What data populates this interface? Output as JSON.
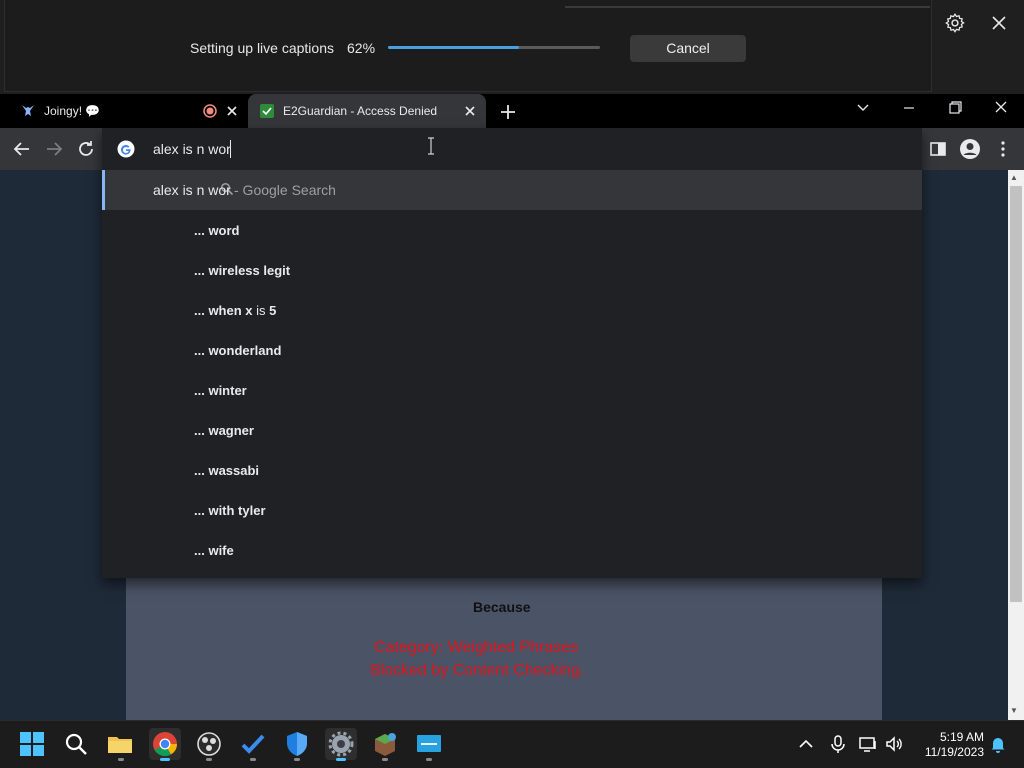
{
  "captions": {
    "status": "Setting up live captions",
    "progress_label": "62%",
    "progress_fraction": 0.62,
    "cancel_label": "Cancel"
  },
  "tabs": [
    {
      "title": "Joingy! 💬"
    },
    {
      "title": "E2Guardian - Access Denied"
    }
  ],
  "omnibox": {
    "query": "alex is n wor",
    "top_suggestion": {
      "query": "alex is n wor",
      "source": " - Google Search"
    },
    "suggestions": [
      {
        "prefix": "... wo",
        "mid": "",
        "rest": "rd"
      },
      {
        "prefix": "... w",
        "mid": "",
        "rest": "ireless legit"
      },
      {
        "prefix": "... when x",
        "mid": " is ",
        "rest": "5"
      },
      {
        "prefix": "... wo",
        "mid": "",
        "rest": "nderland"
      },
      {
        "prefix": "... w",
        "mid": "",
        "rest": "inter"
      },
      {
        "prefix": "... w",
        "mid": "",
        "rest": "agner"
      },
      {
        "prefix": "... w",
        "mid": "",
        "rest": "assabi"
      },
      {
        "prefix": "... w",
        "mid": "",
        "rest": "ith tyler"
      },
      {
        "prefix": "... w",
        "mid": "",
        "rest": "ife"
      }
    ]
  },
  "page": {
    "because": "Because",
    "category": "Category: Weighted Phrases",
    "blocked": "Blocked by Content Checking."
  },
  "taskbar": {
    "time": "5:19 AM",
    "date": "11/19/2023"
  },
  "colors": {
    "accent_blue": "#4a9fe0",
    "block_red": "#e0141b",
    "omnibox_highlight": "#8ab4f8"
  }
}
